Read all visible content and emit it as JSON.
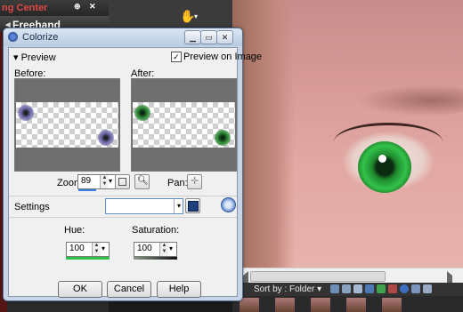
{
  "left_panel": {
    "tab_title": "ng Center",
    "freehand_label": "Freehand"
  },
  "dialog": {
    "title": "Colorize",
    "preview_section_label": "Preview",
    "preview_on_image_label": "Preview on Image",
    "preview_on_image_checked": true,
    "before_label": "Before:",
    "after_label": "After:",
    "zoom_label": "Zoom:",
    "zoom_value": "89",
    "pan_label": "Pan:",
    "settings_label": "Settings",
    "settings_value": "",
    "hue_label": "Hue:",
    "hue_value": "100",
    "saturation_label": "Saturation:",
    "saturation_value": "100",
    "ok_label": "OK",
    "cancel_label": "Cancel",
    "help_label": "Help",
    "colors": {
      "before_blob": "#6b66a8",
      "after_blob": "#2f8a36",
      "hue_bar": "#2ec24a"
    }
  },
  "organizer": {
    "sort_by_label": "Sort by :",
    "folder_label": "Folder"
  }
}
